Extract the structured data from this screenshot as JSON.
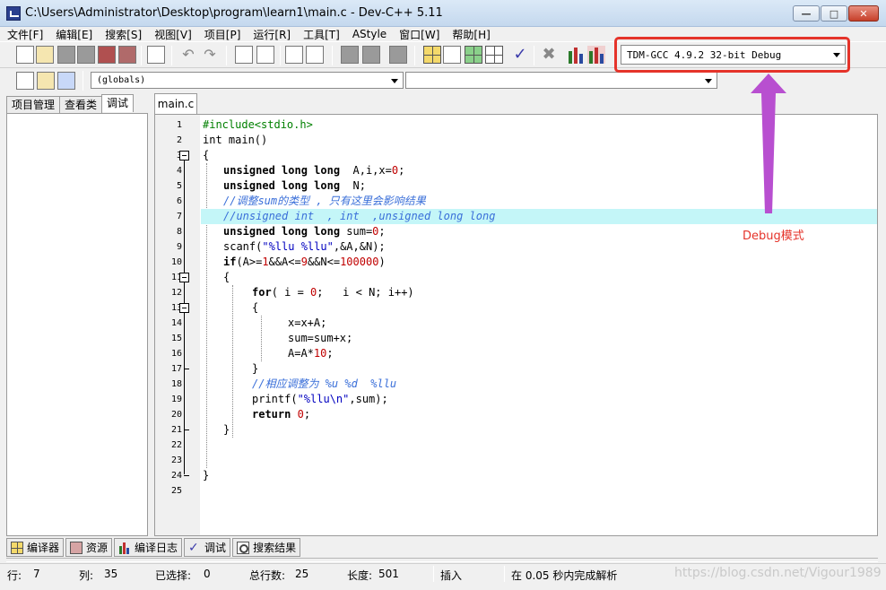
{
  "window": {
    "title": "C:\\Users\\Administrator\\Desktop\\program\\learn1\\main.c - Dev-C++ 5.11",
    "minimize": "—",
    "maximize": "□",
    "close": "✕"
  },
  "menu": [
    "文件[F]",
    "编辑[E]",
    "搜索[S]",
    "视图[V]",
    "项目[P]",
    "运行[R]",
    "工具[T]",
    "AStyle",
    "窗口[W]",
    "帮助[H]"
  ],
  "toolbar": {
    "compiler": "TDM-GCC 4.9.2 32-bit Debug",
    "scope": "(globals)",
    "function": ""
  },
  "left_tabs": [
    "项目管理",
    "查看类",
    "调试"
  ],
  "editor": {
    "tab": "main.c",
    "line_numbers": [
      "1",
      "2",
      "3",
      "4",
      "5",
      "6",
      "7",
      "8",
      "9",
      "10",
      "11",
      "12",
      "13",
      "14",
      "15",
      "16",
      "17",
      "18",
      "19",
      "20",
      "21",
      "22",
      "23",
      "24",
      "25"
    ]
  },
  "code": {
    "l1": "#include<stdio.h>",
    "l2_kw": "int",
    "l2_rest": " main()",
    "l3": "{",
    "l4_kw": "unsigned long long",
    "l4_rest": "  A,i,x=",
    "l4_num": "0",
    "l4_end": ";",
    "l5_kw": "unsigned long long",
    "l5_rest": "  N;",
    "l6": "//调整sum的类型 , 只有这里会影响结果",
    "l7": "//unsigned int  , int  ,unsigned long long",
    "l8_kw": "unsigned long long",
    "l8_rest": " sum=",
    "l8_num": "0",
    "l8_end": ";",
    "l9_a": "scanf(",
    "l9_str": "\"%llu %llu\"",
    "l9_b": ",&A,&N);",
    "l10_kw": "if",
    "l10_a": "(A>=",
    "l10_n1": "1",
    "l10_b": "&&A<=",
    "l10_n2": "9",
    "l10_c": "&&N<=",
    "l10_n3": "100000",
    "l10_d": ")",
    "l11": "{",
    "l12_kw": "for",
    "l12_a": "( i = ",
    "l12_num": "0",
    "l12_b": ";   i < N; i++)",
    "l13": "{",
    "l14": "x=x+A;",
    "l15": "sum=sum+x;",
    "l16_a": "A=A*",
    "l16_num": "10",
    "l16_b": ";",
    "l17": "}",
    "l18": "//相应调整为 %u %d  %llu",
    "l19_a": "printf(",
    "l19_str": "\"%llu\\n\"",
    "l19_b": ",sum);",
    "l20_kw": "return",
    "l20_sp": " ",
    "l20_num": "0",
    "l20_end": ";",
    "l21": "}",
    "l24": "}"
  },
  "annotation": {
    "label": "Debug模式",
    "color": "#e5332a",
    "arrow_color": "#b84fd0"
  },
  "bottom_tabs": [
    "编译器",
    "资源",
    "编译日志",
    "调试",
    "搜索结果"
  ],
  "status": {
    "row_label": "行:",
    "row": "7",
    "col_label": "列:",
    "col": "35",
    "sel_label": "已选择:",
    "sel": "0",
    "total_label": "总行数:",
    "total": "25",
    "len_label": "长度:",
    "len": "501",
    "mode": "插入",
    "parse": "在 0.05 秒内完成解析"
  },
  "watermark": "https://blog.csdn.net/Vigour1989"
}
